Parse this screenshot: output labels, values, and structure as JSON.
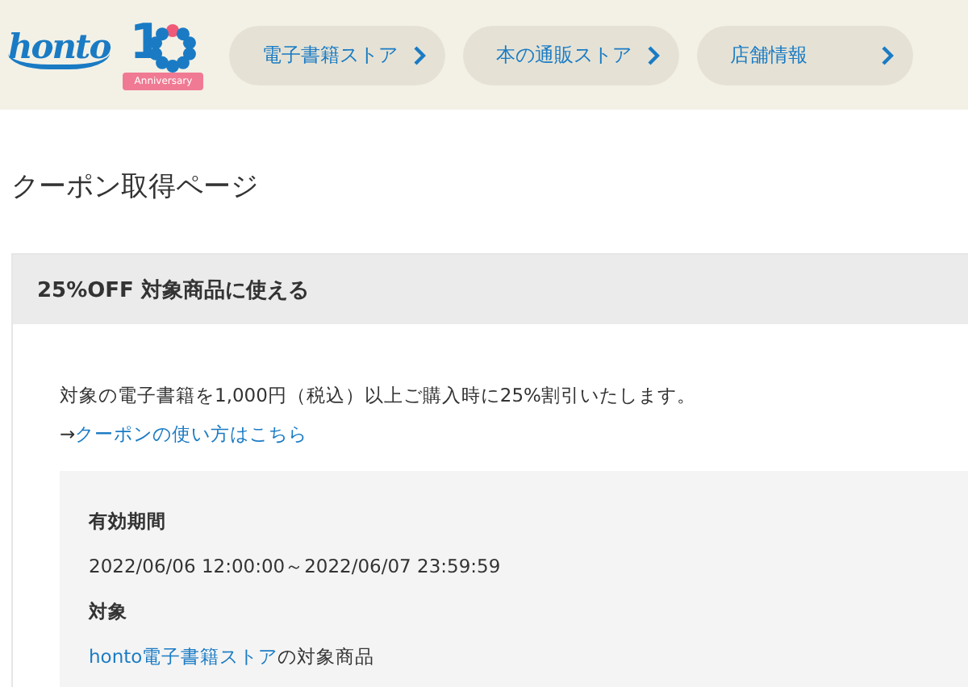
{
  "header": {
    "logo": "honto",
    "anniversary": {
      "numeral": "1",
      "ribbon": "Anniversary"
    },
    "nav": [
      {
        "label": "電子書籍ストア"
      },
      {
        "label": "本の通販ストア"
      },
      {
        "label": "店舗情報"
      }
    ]
  },
  "page_title": "クーポン取得ページ",
  "coupon": {
    "title": "25%OFF 対象商品に使える",
    "description": "対象の電子書籍を1,000円（税込）以上ご購入時に25%割引いたします。",
    "help_prefix": "→",
    "help_link": "クーポンの使い方はこちら",
    "details": [
      {
        "label": "有効期間",
        "value": "2022/06/06 12:00:00～2022/06/07 23:59:59"
      },
      {
        "label": "対象",
        "link": "honto電子書籍ストア",
        "value": "の対象商品"
      }
    ]
  }
}
